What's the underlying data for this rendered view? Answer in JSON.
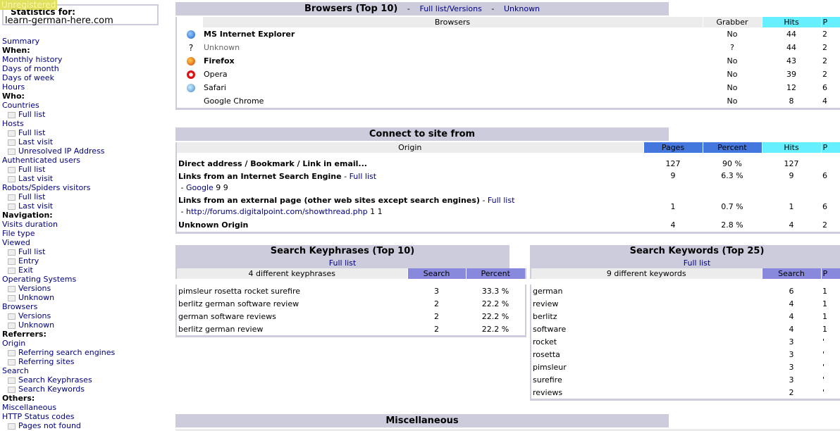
{
  "sidebar": {
    "unregistered": "Unregistered",
    "stats_for": "Statistics for:",
    "site": "learn-german-here.com",
    "items": [
      {
        "t": "Summary",
        "k": "link"
      },
      {
        "t": "When:",
        "k": "h"
      },
      {
        "t": "Monthly history",
        "k": "link"
      },
      {
        "t": "Days of month",
        "k": "link"
      },
      {
        "t": "Days of week",
        "k": "link"
      },
      {
        "t": "Hours",
        "k": "link"
      },
      {
        "t": "Who:",
        "k": "h"
      },
      {
        "t": "Countries",
        "k": "link"
      },
      {
        "t": "Full list",
        "k": "sub"
      },
      {
        "t": "Hosts",
        "k": "link"
      },
      {
        "t": "Full list",
        "k": "sub"
      },
      {
        "t": "Last visit",
        "k": "sub"
      },
      {
        "t": "Unresolved IP Address",
        "k": "sub"
      },
      {
        "t": "Authenticated users",
        "k": "link"
      },
      {
        "t": "Full list",
        "k": "sub"
      },
      {
        "t": "Last visit",
        "k": "sub"
      },
      {
        "t": "Robots/Spiders visitors",
        "k": "link"
      },
      {
        "t": "Full list",
        "k": "sub"
      },
      {
        "t": "Last visit",
        "k": "sub"
      },
      {
        "t": "Navigation:",
        "k": "h"
      },
      {
        "t": "Visits duration",
        "k": "link"
      },
      {
        "t": "File type",
        "k": "link"
      },
      {
        "t": "Viewed",
        "k": "link"
      },
      {
        "t": "Full list",
        "k": "sub"
      },
      {
        "t": "Entry",
        "k": "sub"
      },
      {
        "t": "Exit",
        "k": "sub"
      },
      {
        "t": "Operating Systems",
        "k": "link"
      },
      {
        "t": "Versions",
        "k": "sub"
      },
      {
        "t": "Unknown",
        "k": "sub"
      },
      {
        "t": "Browsers",
        "k": "link"
      },
      {
        "t": "Versions",
        "k": "sub"
      },
      {
        "t": "Unknown",
        "k": "sub"
      },
      {
        "t": "Referrers:",
        "k": "h"
      },
      {
        "t": "Origin",
        "k": "link"
      },
      {
        "t": "Referring search engines",
        "k": "sub"
      },
      {
        "t": "Referring sites",
        "k": "sub"
      },
      {
        "t": "Search",
        "k": "link"
      },
      {
        "t": "Search Keyphrases",
        "k": "sub"
      },
      {
        "t": "Search Keywords",
        "k": "sub"
      },
      {
        "t": "Others:",
        "k": "h"
      },
      {
        "t": "Miscellaneous",
        "k": "link"
      },
      {
        "t": "HTTP Status codes",
        "k": "link"
      },
      {
        "t": "Pages not found",
        "k": "sub"
      }
    ]
  },
  "browsers": {
    "title": "Browsers (Top 10)",
    "sep": "-",
    "full_list": "Full list/Versions",
    "unknown": "Unknown",
    "cols": [
      "Browsers",
      "Grabber",
      "Hits",
      "P"
    ],
    "rows": [
      {
        "icon": "ie-icon",
        "name": "MS Internet Explorer",
        "bold": true,
        "grabber": "No",
        "hits": "44",
        "p": "2"
      },
      {
        "icon": "question-icon",
        "name": "Unknown",
        "gray": true,
        "grabber": "?",
        "hits": "44",
        "p": "2"
      },
      {
        "icon": "firefox-icon",
        "name": "Firefox",
        "bold": true,
        "grabber": "No",
        "hits": "43",
        "p": "2"
      },
      {
        "icon": "opera-icon",
        "name": "Opera",
        "grabber": "No",
        "hits": "39",
        "p": "2"
      },
      {
        "icon": "safari-icon",
        "name": "Safari",
        "grabber": "No",
        "hits": "12",
        "p": "6"
      },
      {
        "icon": "",
        "name": "Google Chrome",
        "grabber": "No",
        "hits": "8",
        "p": "4"
      }
    ]
  },
  "connect": {
    "title": "Connect to site from",
    "cols": [
      "Origin",
      "Pages",
      "Percent",
      "Hits",
      "P"
    ],
    "direct": "Direct address / Bookmark / Link in email...",
    "direct_vals": [
      "127",
      "90 %",
      "127",
      ""
    ],
    "se": "Links from an Internet Search Engine",
    "se_vals": [
      "9",
      "6.3 %",
      "9",
      "6"
    ],
    "full_list": "Full list",
    "dash": "-",
    "google": "Google",
    "google_nums": "9 9",
    "ext": "Links from an external page (other web sites except search engines)",
    "ext_vals": [
      "1",
      "0.7 %",
      "1",
      "6"
    ],
    "ext_url": "http://forums.digitalpoint.com/showthread.php",
    "ext_nums": "1 1",
    "unknown": "Unknown Origin",
    "unknown_vals": [
      "4",
      "2.8 %",
      "4",
      "2"
    ]
  },
  "keyphrases": {
    "title": "Search Keyphrases (Top 10)",
    "full_list": "Full list",
    "cols": [
      "4 different keyphrases",
      "Search",
      "Percent"
    ],
    "rows": [
      [
        "pimsleur rosetta rocket surefire",
        "3",
        "33.3 %"
      ],
      [
        "berlitz german software review",
        "2",
        "22.2 %"
      ],
      [
        "german software reviews",
        "2",
        "22.2 %"
      ],
      [
        "berlitz german review",
        "2",
        "22.2 %"
      ]
    ]
  },
  "keywords": {
    "title": "Search Keywords (Top 25)",
    "full_list": "Full list",
    "cols": [
      "9 different keywords",
      "Search",
      "P"
    ],
    "rows": [
      [
        "german",
        "6",
        "1"
      ],
      [
        "review",
        "4",
        "1"
      ],
      [
        "berlitz",
        "4",
        "1"
      ],
      [
        "software",
        "4",
        "1"
      ],
      [
        "rocket",
        "3",
        "'"
      ],
      [
        "rosetta",
        "3",
        "'"
      ],
      [
        "pimsleur",
        "3",
        "'"
      ],
      [
        "surefire",
        "3",
        "'"
      ],
      [
        "reviews",
        "2",
        "'"
      ]
    ]
  },
  "misc": {
    "title": "Miscellaneous"
  }
}
